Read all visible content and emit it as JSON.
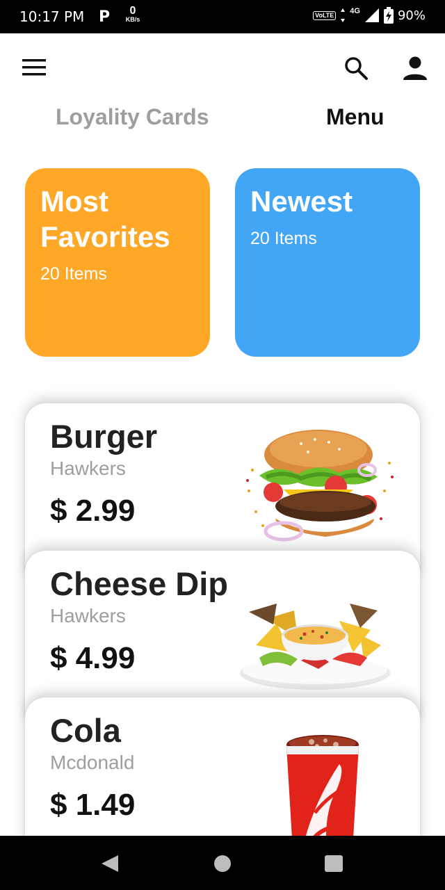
{
  "status_bar": {
    "time": "10:17 PM",
    "p_badge": "P",
    "speed_value": "0",
    "speed_unit": "KB/s",
    "volte": "VoLTE",
    "network": "4G",
    "battery": "90%"
  },
  "app_bar": {
    "menu_icon": "hamburger-menu-icon",
    "search_icon": "search-icon",
    "account_icon": "person-icon"
  },
  "tabs": [
    {
      "label": "Loyality Cards"
    },
    {
      "label": "Menu"
    }
  ],
  "categories": [
    {
      "title_line1": "Most",
      "title_line2": "Favorites",
      "count": "20 Items",
      "color": "#FFA726"
    },
    {
      "title_line1": "Newest",
      "count": "20 Items",
      "color": "#42A5F5"
    }
  ],
  "foods": [
    {
      "name": "Burger",
      "vendor": "Hawkers",
      "price": "$ 2.99"
    },
    {
      "name": "Cheese Dip",
      "vendor": "Hawkers",
      "price": "$ 4.99"
    },
    {
      "name": "Cola",
      "vendor": "Mcdonald",
      "price": "$ 1.49"
    }
  ]
}
